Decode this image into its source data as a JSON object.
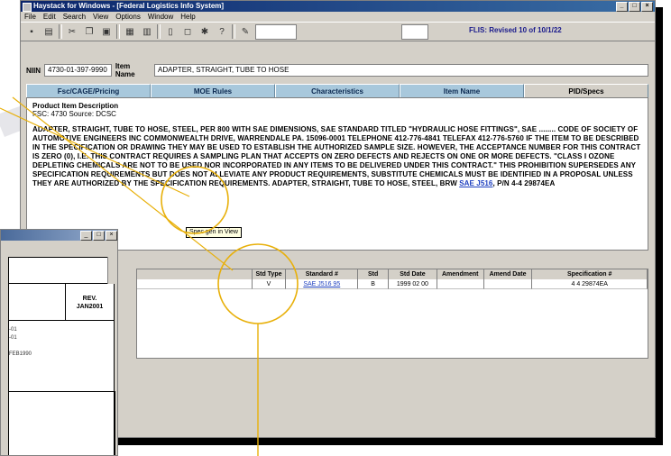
{
  "window": {
    "title": "Haystack for Windows - [Federal Logistics Info System]",
    "min": "_",
    "max": "□",
    "close": "×"
  },
  "menu": [
    "File",
    "Edit",
    "Search",
    "View",
    "Options",
    "Window",
    "Help"
  ],
  "toolbar": {
    "combo_value": "",
    "combo2_value": "",
    "status_text": "FLIS: Revised 10 of 10/1/22"
  },
  "niin": {
    "label": "NIIN",
    "value": "4730-01-397-9990",
    "item_name_label": "Item Name",
    "item_name_value": "ADAPTER, STRAIGHT, TUBE TO HOSE"
  },
  "tabs": [
    "Fsc/CAGE/Pricing",
    "MOE Rules",
    "Characteristics",
    "Item Name",
    "PID/Specs"
  ],
  "description": {
    "heading": "Product Item Description",
    "sub": "FSC: 4730  Source: DCSC",
    "text_before": "ADAPTER, STRAIGHT, TUBE TO HOSE, STEEL, PER 800 WITH SAE DIMENSIONS, SAE STANDARD TITLED \"HYDRAULIC HOSE FITTINGS\", SAE ........ CODE OF SOCIETY OF AUTOMOTIVE ENGINEERS INC COMMONWEALTH DRIVE, WARRENDALE PA. 15096-0001 TELEPHONE 412-776-4841 TELEFAX 412-776-5760 IF THE ITEM TO BE DESCRIBED IN THE SPECIFICATION OR DRAWING THEY MAY BE USED TO ESTABLISH THE AUTHORIZED SAMPLE SIZE. HOWEVER, THE ACCEPTANCE NUMBER FOR THIS CONTRACT IS ZERO (0), I.E. THIS CONTRACT REQUIRES A SAMPLING PLAN THAT ACCEPTS ON ZERO DEFECTS AND REJECTS ON ONE OR MORE DEFECTS. \"CLASS I OZONE DEPLETING CHEMICALS ARE NOT TO BE USED NOR INCORPORATED IN ANY ITEMS TO BE DELIVERED UNDER THIS CONTRACT.\" THIS PROHIBITION SUPERSEDES ANY SPECIFICATION REQUIREMENTS BUT DOES NOT ALLEVIATE ANY PRODUCT REQUIREMENTS, SUBSTITUTE CHEMICALS MUST BE IDENTIFIED IN A PROPOSAL UNLESS THEY ARE AUTHORIZED BY THE SPECIFICATION REQUIREMENTS. ADAPTER, STRAIGHT, TUBE TO HOSE, STEEL, BRW ",
    "link_text": "SAE J516",
    "text_after": ", P/N 4-4 29874EA",
    "tooltip": "Spec gen in View"
  },
  "grid": {
    "headers": [
      "Std Type",
      "Standard #",
      "Std",
      "Std Date",
      "Amendment",
      "Amend Date",
      "Specification #"
    ],
    "rows": [
      [
        "V",
        "SAE J516 95",
        "B",
        "1999 02 00",
        "",
        "",
        "4 4 29874EA"
      ]
    ]
  },
  "second_window": {
    "rev_label": "REV.",
    "rev_value": "JAN2001",
    "lines": [
      "-01",
      "-01",
      "",
      "FEB1990"
    ]
  },
  "colors": {
    "title_bar": "#0a246a",
    "tab_inactive": "#a8c8dc",
    "link": "#1d3fbf",
    "callout": "#e8b00a"
  }
}
